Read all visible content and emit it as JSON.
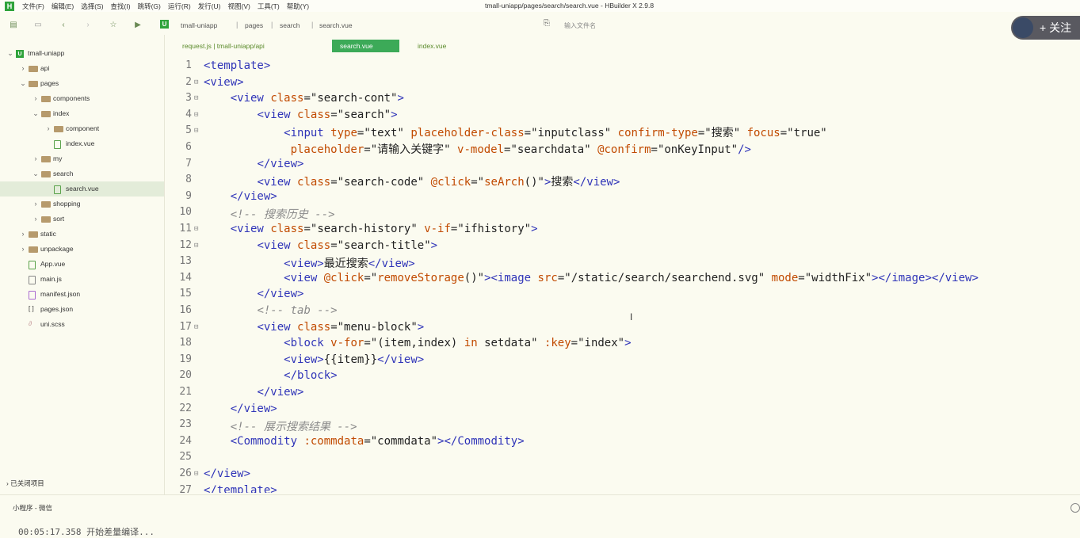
{
  "menubar": {
    "logo": "H",
    "items": [
      "文件(F)",
      "编辑(E)",
      "选择(S)",
      "查找(I)",
      "跳转(G)",
      "运行(R)",
      "发行(U)",
      "视图(V)",
      "工具(T)",
      "帮助(Y)"
    ],
    "window_title": "tmall-uniapp/pages/search/search.vue - HBuilder X 2.9.8"
  },
  "toolbar": {
    "project_badge": "U",
    "breadcrumb": [
      "tmall-uniapp",
      "pages",
      "search",
      "search.vue"
    ],
    "file_search_placeholder": "输入文件名",
    "follow_label": "+ 关注"
  },
  "sidebar": {
    "tree": [
      {
        "label": "tmall-uniapp",
        "depth": 0,
        "type": "project",
        "expanded": true
      },
      {
        "label": "api",
        "depth": 1,
        "type": "folder",
        "expanded": false
      },
      {
        "label": "pages",
        "depth": 1,
        "type": "folder",
        "expanded": true
      },
      {
        "label": "components",
        "depth": 2,
        "type": "folder",
        "expanded": false
      },
      {
        "label": "index",
        "depth": 2,
        "type": "folder",
        "expanded": true
      },
      {
        "label": "component",
        "depth": 3,
        "type": "folder",
        "expanded": false
      },
      {
        "label": "index.vue",
        "depth": 3,
        "type": "vue"
      },
      {
        "label": "my",
        "depth": 2,
        "type": "folder",
        "expanded": false
      },
      {
        "label": "search",
        "depth": 2,
        "type": "folder",
        "expanded": true
      },
      {
        "label": "search.vue",
        "depth": 3,
        "type": "vue",
        "selected": true
      },
      {
        "label": "shopping",
        "depth": 2,
        "type": "folder",
        "expanded": false
      },
      {
        "label": "sort",
        "depth": 2,
        "type": "folder",
        "expanded": false
      },
      {
        "label": "static",
        "depth": 1,
        "type": "folder",
        "expanded": false
      },
      {
        "label": "unpackage",
        "depth": 1,
        "type": "folder",
        "expanded": false
      },
      {
        "label": "App.vue",
        "depth": 1,
        "type": "vue"
      },
      {
        "label": "main.js",
        "depth": 1,
        "type": "js"
      },
      {
        "label": "manifest.json",
        "depth": 1,
        "type": "json"
      },
      {
        "label": "pages.json",
        "depth": 1,
        "type": "brackets"
      },
      {
        "label": "uni.scss",
        "depth": 1,
        "type": "scss"
      }
    ],
    "closed_projects": "已关闭项目"
  },
  "tabs": [
    {
      "label": "request.js | tmall-uniapp/api",
      "active": false
    },
    {
      "label": "search.vue",
      "active": true
    },
    {
      "label": "index.vue",
      "active": false
    }
  ],
  "editor": {
    "lines": [
      {
        "n": "1",
        "fold": "",
        "html": "<span class='tg'>&lt;template&gt;</span>"
      },
      {
        "n": "2",
        "fold": "⊟",
        "html": "<span class='tg'>&lt;view&gt;</span>"
      },
      {
        "n": "3",
        "fold": "⊟",
        "html": "    <span class='tg'>&lt;view</span> <span class='at'>class</span>=<span class='st'>\"search-cont\"</span><span class='tg'>&gt;</span>"
      },
      {
        "n": "4",
        "fold": "⊟",
        "html": "        <span class='tg'>&lt;view</span> <span class='at'>class</span>=<span class='st'>\"search\"</span><span class='tg'>&gt;</span>"
      },
      {
        "n": "5",
        "fold": "⊟",
        "html": "            <span class='tg'>&lt;input</span> <span class='at'>type</span>=<span class='st'>\"text\"</span> <span class='at'>placeholder-class</span>=<span class='st'>\"inputclass\"</span> <span class='at'>confirm-type</span>=<span class='st'>\"搜索\"</span> <span class='at'>focus</span>=<span class='st'>\"true\"</span>"
      },
      {
        "n": "6",
        "fold": "",
        "html": "             <span class='at'>placeholder</span>=<span class='st'>\"请输入关键字\"</span> <span class='at'>v-model</span>=<span class='st'>\"searchdata\"</span> <span class='at'>@confirm</span>=<span class='st'>\"onKeyInput\"</span><span class='tg'>/&gt;</span>"
      },
      {
        "n": "7",
        "fold": "",
        "html": "        <span class='tg'>&lt;/view&gt;</span>"
      },
      {
        "n": "8",
        "fold": "",
        "html": "        <span class='tg'>&lt;view</span> <span class='at'>class</span>=<span class='st'>\"search-code\"</span> <span class='at'>@click</span>=<span class='st'>\"<span class='at'>seArch</span>()\"</span><span class='tg'>&gt;</span><span class='txt'>搜索</span><span class='tg'>&lt;/view&gt;</span>"
      },
      {
        "n": "9",
        "fold": "",
        "html": "    <span class='tg'>&lt;/view&gt;</span>"
      },
      {
        "n": "10",
        "fold": "",
        "html": "    <span class='cm'>&lt;!-- 搜索历史 --&gt;</span>"
      },
      {
        "n": "11",
        "fold": "⊟",
        "html": "    <span class='tg'>&lt;view</span> <span class='at'>class</span>=<span class='st'>\"search-history\"</span> <span class='at'>v-if</span>=<span class='st'>\"ifhistory\"</span><span class='tg'>&gt;</span>"
      },
      {
        "n": "12",
        "fold": "⊟",
        "html": "        <span class='tg'>&lt;view</span> <span class='at'>class</span>=<span class='st'>\"search-title\"</span><span class='tg'>&gt;</span>"
      },
      {
        "n": "13",
        "fold": "",
        "html": "            <span class='tg'>&lt;view&gt;</span><span class='txt'>最近搜索</span><span class='tg'>&lt;/view&gt;</span>"
      },
      {
        "n": "14",
        "fold": "",
        "html": "            <span class='tg'>&lt;view</span> <span class='at'>@click</span>=<span class='st'>\"<span class='at'>removeStorage</span>()\"</span><span class='tg'>&gt;&lt;image</span> <span class='at'>src</span>=<span class='st'>\"/static/search/searchend.svg\"</span> <span class='at'>mode</span>=<span class='st'>\"widthFix\"</span><span class='tg'>&gt;&lt;/image&gt;&lt;/view&gt;</span>"
      },
      {
        "n": "15",
        "fold": "",
        "html": "        <span class='tg'>&lt;/view&gt;</span>"
      },
      {
        "n": "16",
        "fold": "",
        "html": "        <span class='cm'>&lt;!-- tab --&gt;</span>"
      },
      {
        "n": "17",
        "fold": "⊟",
        "html": "        <span class='tg'>&lt;view</span> <span class='at'>class</span>=<span class='st'>\"menu-block\"</span><span class='tg'>&gt;</span>"
      },
      {
        "n": "18",
        "fold": "",
        "html": "            <span class='tg'>&lt;block</span> <span class='at'>v-for</span>=<span class='st'>\"(item,index) <span class='at'>in</span> setdata\"</span> <span class='at'>:key</span>=<span class='st'>\"index\"</span><span class='tg'>&gt;</span>"
      },
      {
        "n": "19",
        "fold": "",
        "html": "            <span class='tg'>&lt;view&gt;</span><span class='txt'>{{item}}</span><span class='tg'>&lt;/view&gt;</span>"
      },
      {
        "n": "20",
        "fold": "",
        "html": "            <span class='tg'>&lt;/block&gt;</span>"
      },
      {
        "n": "21",
        "fold": "",
        "html": "        <span class='tg'>&lt;/view&gt;</span>"
      },
      {
        "n": "22",
        "fold": "",
        "html": "    <span class='tg'>&lt;/view&gt;</span>"
      },
      {
        "n": "23",
        "fold": "",
        "html": "    <span class='cm'>&lt;!-- 展示搜索结果 --&gt;</span>"
      },
      {
        "n": "24",
        "fold": "",
        "html": "    <span class='tg'>&lt;Commodity</span> <span class='at'>:commdata</span>=<span class='st'>\"commdata\"</span><span class='tg'>&gt;&lt;/Commodity&gt;</span>"
      },
      {
        "n": "25",
        "fold": "",
        "html": ""
      },
      {
        "n": "26",
        "fold": "⊟",
        "html": "<span class='tg'>&lt;/view&gt;</span>"
      },
      {
        "n": "27",
        "fold": "",
        "html": "<span class='tg'>&lt;/template&gt;</span>"
      }
    ]
  },
  "bottom": {
    "tab_label": "小程序 - 微信",
    "console_line": "00:05:17.358 开始差量编译..."
  }
}
